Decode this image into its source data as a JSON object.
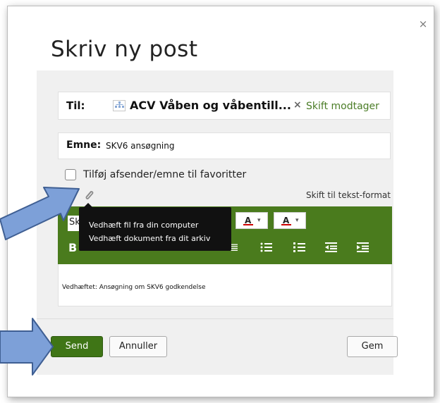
{
  "dialog": {
    "close_symbol": "×",
    "title": "Skriv ny post"
  },
  "recipient": {
    "label": "Til:",
    "name": "ACV Våben og våbentill...",
    "remove_symbol": "×",
    "change_label": "Skift modtager"
  },
  "subject": {
    "label": "Emne:",
    "value": "SKV6 ansøgning"
  },
  "favorites": {
    "label": "Tilføj afsender/emne til favoritter",
    "checked": false
  },
  "format_bar": {
    "font_icon_glyph": "A",
    "plain_text_label": "Skift til tekst-format"
  },
  "toolbar": {
    "font_label_fragment": "Sk",
    "text_color_label": "A",
    "highlight_label": "A",
    "dropdown_caret": "▾",
    "bold_label": "B",
    "icons": [
      "italic-icon",
      "align-left-icon",
      "align-center-icon",
      "align-right-icon",
      "align-justify-icon",
      "bulleted-list-icon",
      "numbered-list-icon",
      "outdent-icon",
      "indent-icon"
    ],
    "accent_color": "#4a7b1d"
  },
  "attach_menu": {
    "items": [
      "Vedhæft fil fra din computer",
      "Vedhæft dokument fra dit arkiv"
    ]
  },
  "editor": {
    "body_text": "Vedhæftet: Ansøgning om SKV6 godkendelse"
  },
  "buttons": {
    "send": "Send",
    "cancel": "Annuller",
    "save": "Gem",
    "send_color": "#3f7516"
  },
  "annotation": {
    "arrow_color": "#7da0d8"
  }
}
